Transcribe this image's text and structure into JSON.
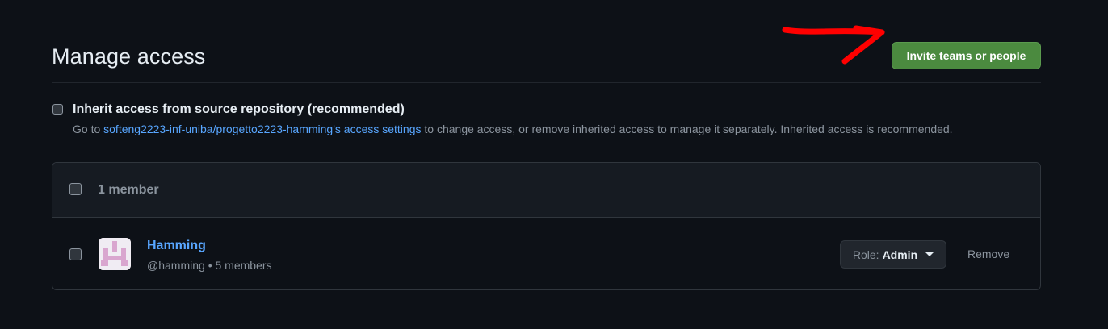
{
  "page": {
    "title": "Manage access",
    "invite_button": "Invite teams or people"
  },
  "inherit": {
    "label": "Inherit access from source repository (recommended)",
    "desc_prefix": "Go to ",
    "desc_link": "softeng2223-inf-uniba/progetto2223-hamming's access settings",
    "desc_suffix": " to change access, or remove inherited access to manage it separately. Inherited access is recommended."
  },
  "members": {
    "count_label": "1 member",
    "rows": [
      {
        "name": "Hamming",
        "handle": "@hamming",
        "separator": "•",
        "member_count": "5 members",
        "role_prefix": "Role:",
        "role_value": "Admin",
        "remove_label": "Remove"
      }
    ]
  },
  "colors": {
    "background": "#0d1117",
    "accent_green": "#4b8a3f",
    "link_blue": "#58a6ff",
    "annotation_red": "#ff0000"
  },
  "icons": {
    "avatar": "hamming-team-logo",
    "role_dropdown": "caret-down-icon",
    "annotation": "red-arrow-annotation"
  }
}
